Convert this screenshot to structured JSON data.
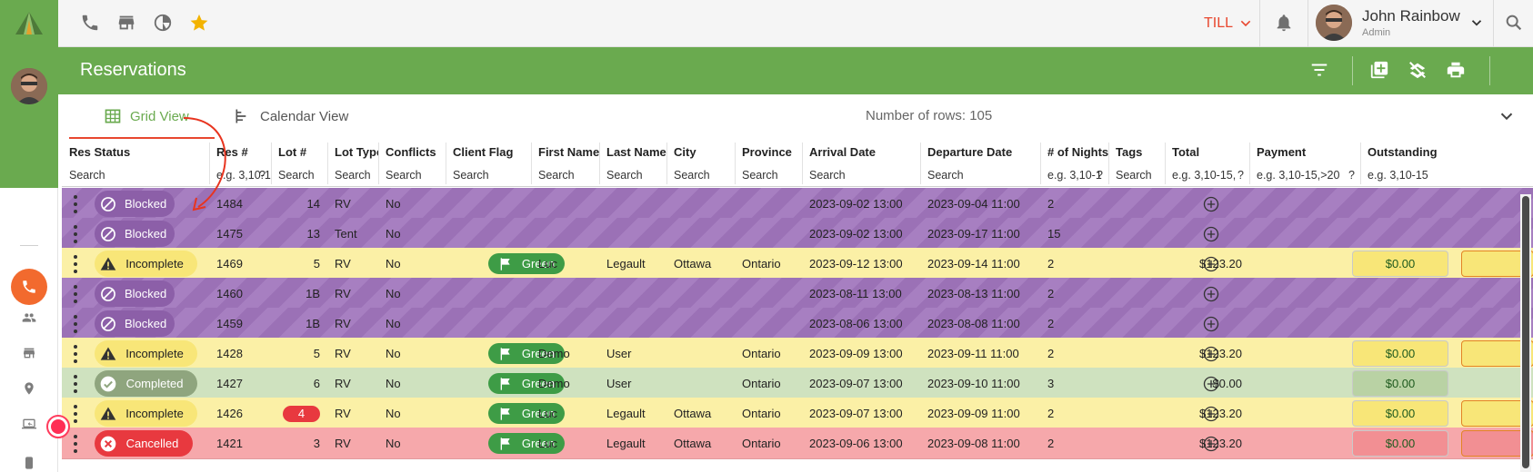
{
  "app": {
    "user": {
      "name": "John Rainbow",
      "role": "Admin"
    },
    "till_label": "TILL"
  },
  "topbar": {
    "icons": [
      "phone-icon",
      "store-icon",
      "pie-chart-icon",
      "star-icon",
      "bell-icon",
      "chevron-down-icon",
      "search-icon"
    ]
  },
  "titlebar": {
    "title": "Reservations",
    "icons": [
      "filter-icon",
      "add-reservation-icon",
      "clear-layers-icon",
      "print-icon"
    ]
  },
  "tabs": [
    {
      "label": "Grid View",
      "icon": "grid-icon",
      "active": true
    },
    {
      "label": "Calendar View",
      "icon": "calendar-view-icon",
      "active": false
    }
  ],
  "row_count_text": "Number of rows: 105",
  "columns": [
    {
      "key": "res_status",
      "label": "Res Status",
      "filter": "Search"
    },
    {
      "key": "res_num",
      "label": "Res #",
      "filter": "e.g. 3,10-1",
      "help": "?"
    },
    {
      "key": "lot_num",
      "label": "Lot #",
      "filter": "Search"
    },
    {
      "key": "lot_type",
      "label": "Lot Type",
      "filter": "Search"
    },
    {
      "key": "conflicts",
      "label": "Conflicts",
      "filter": "Search"
    },
    {
      "key": "client_flag",
      "label": "Client Flag",
      "filter": "Search"
    },
    {
      "key": "first_name",
      "label": "First Name",
      "filter": "Search"
    },
    {
      "key": "last_name",
      "label": "Last Name",
      "filter": "Search"
    },
    {
      "key": "city",
      "label": "City",
      "filter": "Search"
    },
    {
      "key": "province",
      "label": "Province",
      "filter": "Search"
    },
    {
      "key": "arrival",
      "label": "Arrival Date",
      "filter": "Search"
    },
    {
      "key": "departure",
      "label": "Departure Date",
      "filter": "Search"
    },
    {
      "key": "nights",
      "label": "# of Nights",
      "filter": "e.g. 3,10-1",
      "help": "?"
    },
    {
      "key": "tags",
      "label": "Tags",
      "filter": "Search"
    },
    {
      "key": "total",
      "label": "Total",
      "filter": "e.g. 3,10-15,",
      "help": "?"
    },
    {
      "key": "payment",
      "label": "Payment",
      "filter": "e.g. 3,10-15,>20",
      "help": "?"
    },
    {
      "key": "outstanding",
      "label": "Outstanding",
      "filter": "e.g. 3,10-15"
    }
  ],
  "rows": [
    {
      "status": "Blocked",
      "kind": "blocked",
      "res": "1484",
      "lot": "14",
      "lot_conflict": false,
      "type": "RV",
      "conflicts": "No",
      "flag": "",
      "first": "",
      "last": "",
      "city": "",
      "province": "",
      "arrival": "2023-09-02 13:00",
      "departure": "2023-09-04 11:00",
      "nights": "2",
      "total": "",
      "payment": ""
    },
    {
      "status": "Blocked",
      "kind": "blocked",
      "res": "1475",
      "lot": "13",
      "lot_conflict": false,
      "type": "Tent",
      "conflicts": "No",
      "flag": "",
      "first": "",
      "last": "",
      "city": "",
      "province": "",
      "arrival": "2023-09-02 13:00",
      "departure": "2023-09-17 11:00",
      "nights": "15",
      "total": "",
      "payment": ""
    },
    {
      "status": "Incomplete",
      "kind": "incomplete",
      "res": "1469",
      "lot": "5",
      "lot_conflict": false,
      "type": "RV",
      "conflicts": "No",
      "flag": "Green",
      "first": "Luc",
      "last": "Legault",
      "city": "Ottawa",
      "province": "Ontario",
      "arrival": "2023-09-12 13:00",
      "departure": "2023-09-14 11:00",
      "nights": "2",
      "total": "$123.20",
      "payment": "$0.00"
    },
    {
      "status": "Blocked",
      "kind": "blocked",
      "res": "1460",
      "lot": "1B",
      "lot_conflict": false,
      "type": "RV",
      "conflicts": "No",
      "flag": "",
      "first": "",
      "last": "",
      "city": "",
      "province": "",
      "arrival": "2023-08-11 13:00",
      "departure": "2023-08-13 11:00",
      "nights": "2",
      "total": "",
      "payment": ""
    },
    {
      "status": "Blocked",
      "kind": "blocked",
      "res": "1459",
      "lot": "1B",
      "lot_conflict": false,
      "type": "RV",
      "conflicts": "No",
      "flag": "",
      "first": "",
      "last": "",
      "city": "",
      "province": "",
      "arrival": "2023-08-06 13:00",
      "departure": "2023-08-08 11:00",
      "nights": "2",
      "total": "",
      "payment": ""
    },
    {
      "status": "Incomplete",
      "kind": "incomplete",
      "res": "1428",
      "lot": "5",
      "lot_conflict": false,
      "type": "RV",
      "conflicts": "No",
      "flag": "Green",
      "first": "Demo",
      "last": "User",
      "city": "",
      "province": "Ontario",
      "arrival": "2023-09-09 13:00",
      "departure": "2023-09-11 11:00",
      "nights": "2",
      "total": "$123.20",
      "payment": "$0.00"
    },
    {
      "status": "Completed",
      "kind": "completed",
      "res": "1427",
      "lot": "6",
      "lot_conflict": false,
      "type": "RV",
      "conflicts": "No",
      "flag": "Green",
      "first": "Demo",
      "last": "User",
      "city": "",
      "province": "Ontario",
      "arrival": "2023-09-07 13:00",
      "departure": "2023-09-10 11:00",
      "nights": "3",
      "total": "$0.00",
      "payment": "$0.00"
    },
    {
      "status": "Incomplete",
      "kind": "incomplete",
      "res": "1426",
      "lot": "4",
      "lot_conflict": true,
      "type": "RV",
      "conflicts": "No",
      "flag": "Green",
      "first": "Luc",
      "last": "Legault",
      "city": "Ottawa",
      "province": "Ontario",
      "arrival": "2023-09-07 13:00",
      "departure": "2023-09-09 11:00",
      "nights": "2",
      "total": "$123.20",
      "payment": "$0.00"
    },
    {
      "status": "Cancelled",
      "kind": "cancelled",
      "res": "1421",
      "lot": "3",
      "lot_conflict": false,
      "type": "RV",
      "conflicts": "No",
      "flag": "Green",
      "first": "Luc",
      "last": "Legault",
      "city": "Ottawa",
      "province": "Ontario",
      "arrival": "2023-09-06 13:00",
      "departure": "2023-09-08 11:00",
      "nights": "2",
      "total": "$123.20",
      "payment": "$0.00"
    }
  ],
  "colors": {
    "brand_green": "#6aaa4f",
    "accent_red": "#e8472f",
    "blocked": "#9b71b6",
    "incomplete": "#fbf0a6",
    "completed": "#cfe2bf",
    "cancelled": "#f6a8ab"
  }
}
